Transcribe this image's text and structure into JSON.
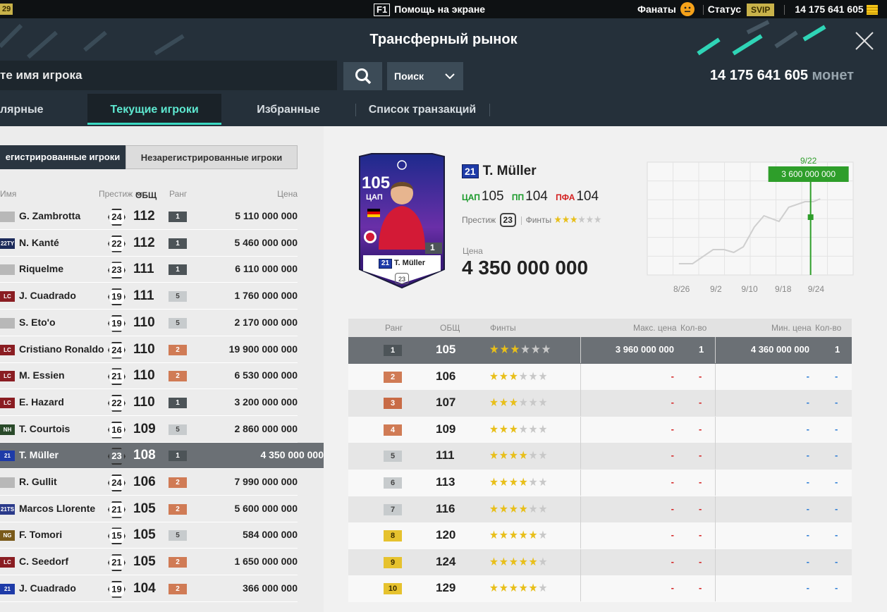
{
  "topbar": {
    "left_badge": "29",
    "help_key": "F1",
    "help_label": "Помощь на экране",
    "fans_label": "Фанаты",
    "status_label": "Статус",
    "status_value": "SVIP",
    "coins": "14 175 641 605"
  },
  "header": {
    "title": "Трансферный рынок",
    "search_text": "те имя игрока",
    "dropdown_value": "Поиск",
    "balance_value": "14 175 641 605",
    "balance_unit": "монет"
  },
  "tabs": [
    {
      "label": "лярные игроки"
    },
    {
      "label": "Текущие игроки"
    },
    {
      "label": "Избранные"
    },
    {
      "label": "Список транзакций"
    }
  ],
  "registration": {
    "registered": "егистрированные игроки",
    "unregistered": "Незарегистрированные игроки"
  },
  "list_columns": {
    "name": "Имя",
    "prestige": "Престиж",
    "ovr": "ОБЩ",
    "rank": "Ранг",
    "price": "Цена"
  },
  "players": [
    {
      "badge": "",
      "name": "G. Zambrotta",
      "prestige": "24",
      "ovr": "112",
      "rank": "1",
      "price": "5 110 000 000"
    },
    {
      "badge": "22TY",
      "name": "N. Kanté",
      "prestige": "22",
      "ovr": "112",
      "rank": "1",
      "price": "5 460 000 000"
    },
    {
      "badge": "",
      "name": "Riquelme",
      "prestige": "23",
      "ovr": "111",
      "rank": "1",
      "price": "6 110 000 000"
    },
    {
      "badge": "LC",
      "name": "J. Cuadrado",
      "prestige": "19",
      "ovr": "111",
      "rank": "5",
      "price": "1 760 000 000"
    },
    {
      "badge": "",
      "name": "S. Eto'o",
      "prestige": "19",
      "ovr": "110",
      "rank": "5",
      "price": "2 170 000 000"
    },
    {
      "badge": "LC",
      "name": "Cristiano Ronaldo",
      "prestige": "24",
      "ovr": "110",
      "rank": "2",
      "price": "19 900 000 000"
    },
    {
      "badge": "LC",
      "name": "M. Essien",
      "prestige": "21",
      "ovr": "110",
      "rank": "2",
      "price": "6 530 000 000"
    },
    {
      "badge": "LC",
      "name": "E. Hazard",
      "prestige": "22",
      "ovr": "110",
      "rank": "1",
      "price": "3 200 000 000"
    },
    {
      "badge": "NH",
      "name": "T. Courtois",
      "prestige": "16",
      "ovr": "109",
      "rank": "5",
      "price": "2 860 000 000"
    },
    {
      "badge": "21",
      "name": "T. Müller",
      "prestige": "23",
      "ovr": "108",
      "rank": "1",
      "price": "4 350 000 000"
    },
    {
      "badge": "",
      "name": "R. Gullit",
      "prestige": "24",
      "ovr": "106",
      "rank": "2",
      "price": "7 990 000 000"
    },
    {
      "badge": "21TS",
      "name": "Marcos Llorente",
      "prestige": "21",
      "ovr": "105",
      "rank": "2",
      "price": "5 600 000 000"
    },
    {
      "badge": "NG",
      "name": "F. Tomori",
      "prestige": "15",
      "ovr": "105",
      "rank": "5",
      "price": "584 000 000"
    },
    {
      "badge": "LC",
      "name": "C. Seedorf",
      "prestige": "21",
      "ovr": "105",
      "rank": "2",
      "price": "1 650 000 000"
    },
    {
      "badge": "21",
      "name": "J. Cuadrado",
      "prestige": "19",
      "ovr": "104",
      "rank": "2",
      "price": "366 000 000"
    }
  ],
  "card": {
    "ovr": "105",
    "position": "ЦАП",
    "rank": "1",
    "club_num": "21",
    "name": "T. Müller",
    "prestige": "23"
  },
  "detail": {
    "club_num": "21",
    "name": "T. Müller",
    "pos1": "ЦАП",
    "val1": "105",
    "pos2": "ПП",
    "val2": "104",
    "pos3": "ПФА",
    "val3": "104",
    "prestige_label": "Престиж",
    "prestige": "23",
    "skills_label": "Финты",
    "skills": 3,
    "price_label": "Цена",
    "price": "4 350 000 000"
  },
  "chart_data": {
    "type": "line",
    "x": [
      "8/26",
      "9/2",
      "9/10",
      "9/18",
      "9/24"
    ],
    "values": [
      2.4,
      2.45,
      2.9,
      2.85,
      3.3,
      3.6,
      3.45,
      3.6,
      3.4,
      3.5
    ],
    "marker_date": "9/22",
    "marker_value": "3 600 000 000",
    "grid": true
  },
  "rank_columns": {
    "rank": "Ранг",
    "ovr": "ОБЩ",
    "skills": "Финты",
    "max_price": "Макс. цена",
    "max_qty": "Кол-во",
    "min_price": "Мин. цена",
    "min_qty": "Кол-во"
  },
  "ranks": [
    {
      "rank": "1",
      "ovr": "105",
      "skills": 3,
      "max_price": "3 960 000 000",
      "max_qty": "1",
      "min_price": "4 360 000 000",
      "min_qty": "1"
    },
    {
      "rank": "2",
      "ovr": "106",
      "skills": 3,
      "max_price": "-",
      "max_qty": "-",
      "min_price": "-",
      "min_qty": "-"
    },
    {
      "rank": "3",
      "ovr": "107",
      "skills": 3,
      "max_price": "-",
      "max_qty": "-",
      "min_price": "-",
      "min_qty": "-"
    },
    {
      "rank": "4",
      "ovr": "109",
      "skills": 3,
      "max_price": "-",
      "max_qty": "-",
      "min_price": "-",
      "min_qty": "-"
    },
    {
      "rank": "5",
      "ovr": "111",
      "skills": 4,
      "max_price": "-",
      "max_qty": "-",
      "min_price": "-",
      "min_qty": "-"
    },
    {
      "rank": "6",
      "ovr": "113",
      "skills": 4,
      "max_price": "-",
      "max_qty": "-",
      "min_price": "-",
      "min_qty": "-"
    },
    {
      "rank": "7",
      "ovr": "116",
      "skills": 4,
      "max_price": "-",
      "max_qty": "-",
      "min_price": "-",
      "min_qty": "-"
    },
    {
      "rank": "8",
      "ovr": "120",
      "skills": 5,
      "max_price": "-",
      "max_qty": "-",
      "min_price": "-",
      "min_qty": "-"
    },
    {
      "rank": "9",
      "ovr": "124",
      "skills": 5,
      "max_price": "-",
      "max_qty": "-",
      "min_price": "-",
      "min_qty": "-"
    },
    {
      "rank": "10",
      "ovr": "129",
      "skills": 5,
      "max_price": "-",
      "max_qty": "-",
      "min_price": "-",
      "min_qty": "-"
    }
  ]
}
